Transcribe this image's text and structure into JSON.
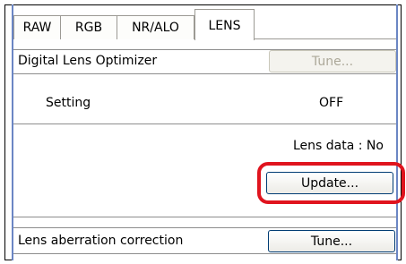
{
  "tabs": [
    {
      "label": "RAW",
      "active": false
    },
    {
      "label": "RGB",
      "active": false
    },
    {
      "label": "NR/ALO",
      "active": false
    },
    {
      "label": "LENS",
      "active": true
    }
  ],
  "dlo": {
    "title": "Digital Lens Optimizer",
    "tune_label": "Tune...",
    "setting_label": "Setting",
    "setting_value": "OFF",
    "lens_data_label": "Lens data : No",
    "update_label": "Update..."
  },
  "lac": {
    "title": "Lens aberration correction",
    "tune_label": "Tune..."
  },
  "colors": {
    "highlight": "#e0141e",
    "frame": "#6b86c4"
  }
}
